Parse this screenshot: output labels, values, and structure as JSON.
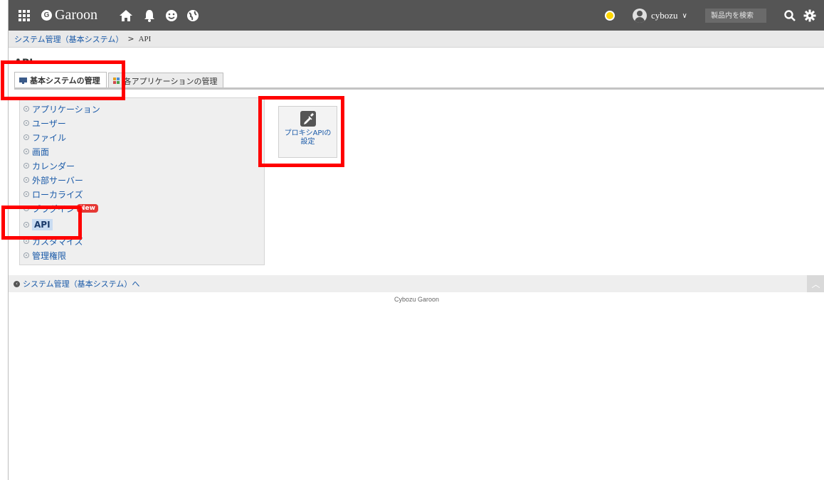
{
  "app": {
    "name": "Garoon"
  },
  "header": {
    "username": "cybozu",
    "search_placeholder": "製品内を検索"
  },
  "breadcrumb": {
    "parent": "システム管理（基本システム）",
    "separator": ">",
    "current": "API"
  },
  "page": {
    "title": "API"
  },
  "tabs": [
    {
      "label": "基本システムの管理",
      "active": true
    },
    {
      "label": "各アプリケーションの管理",
      "active": false
    }
  ],
  "menu": {
    "items": [
      {
        "label": "アプリケーション"
      },
      {
        "label": "ユーザー"
      },
      {
        "label": "ファイル"
      },
      {
        "label": "画面"
      },
      {
        "label": "カレンダー"
      },
      {
        "label": "外部サーバー"
      },
      {
        "label": "ローカライズ"
      },
      {
        "label": "プラグイン",
        "badge": "New"
      },
      {
        "label": "API",
        "current": true
      },
      {
        "label": "カスタマイズ"
      },
      {
        "label": "管理権限"
      }
    ]
  },
  "tile": {
    "line1": "プロキシAPIの",
    "line2": "設定",
    "icon": "plug-edit-icon"
  },
  "back_link": "システム管理（基本システム）へ",
  "footer": "Cybozu Garoon",
  "colors": {
    "topbar": "#555555",
    "link": "#1a5aa8",
    "highlight": "#ff0000",
    "badge": "#e53935"
  }
}
